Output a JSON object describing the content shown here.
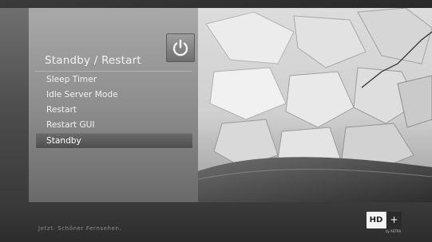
{
  "panel": {
    "title": "Standby / Restart",
    "icon": "power-icon"
  },
  "menu": {
    "items": [
      {
        "label": "Sleep Timer",
        "selected": false
      },
      {
        "label": "Idle Server Mode",
        "selected": false
      },
      {
        "label": "Restart",
        "selected": false
      },
      {
        "label": "Restart GUI",
        "selected": false
      },
      {
        "label": "Standby",
        "selected": true
      }
    ]
  },
  "footer": {
    "slogan": "Jetzt. Schöner Fernsehen.",
    "logo_hd": "HD",
    "logo_plus": "+",
    "logo_sub": "by ASTRA"
  },
  "colors": {
    "accent_tile": "#8a8a8a",
    "selected_row": "#5b5b5b",
    "panel": "#8f8f8f"
  }
}
